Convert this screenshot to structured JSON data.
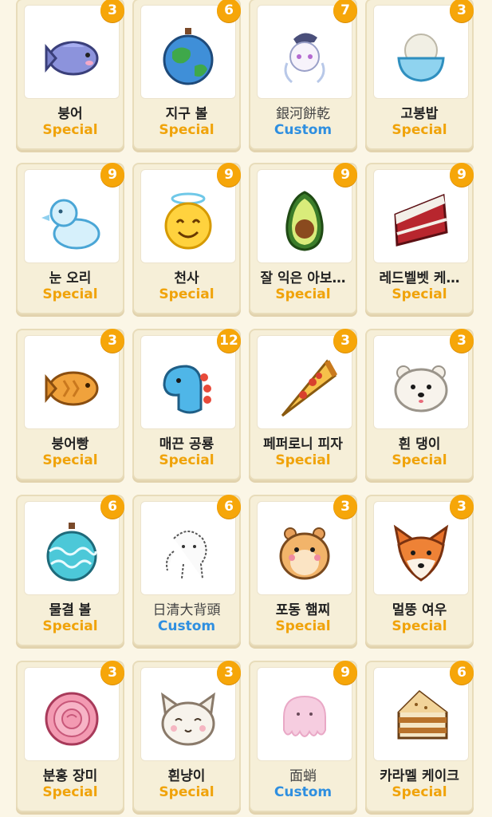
{
  "colors": {
    "special": "#f0a30a",
    "custom": "#2f8fe0",
    "badge": "#f6a609",
    "card_bg": "#f6efd8",
    "page_bg": "#fbf6e6"
  },
  "items": [
    {
      "badge": "3",
      "name": "붕어",
      "type": "Special",
      "icon": "blue-fish-icon"
    },
    {
      "badge": "6",
      "name": "지구 볼",
      "type": "Special",
      "icon": "earth-ornament-icon"
    },
    {
      "badge": "7",
      "name": "銀河餅乾",
      "type": "Custom",
      "icon": "custom-sketch-girl-icon"
    },
    {
      "badge": "3",
      "name": "고봉밥",
      "type": "Special",
      "icon": "rice-bowl-icon"
    },
    {
      "badge": "9",
      "name": "눈 오리",
      "type": "Special",
      "icon": "snow-duck-icon"
    },
    {
      "badge": "9",
      "name": "천사",
      "type": "Special",
      "icon": "angel-face-icon"
    },
    {
      "badge": "9",
      "name": "잘 익은 아보…",
      "type": "Special",
      "icon": "avocado-icon"
    },
    {
      "badge": "9",
      "name": "레드벨벳 케…",
      "type": "Special",
      "icon": "red-velvet-cake-icon"
    },
    {
      "badge": "3",
      "name": "붕어빵",
      "type": "Special",
      "icon": "fish-bread-icon"
    },
    {
      "badge": "12",
      "name": "매끈 공룡",
      "type": "Special",
      "icon": "dinosaur-icon"
    },
    {
      "badge": "3",
      "name": "페퍼로니 피자",
      "type": "Special",
      "icon": "pizza-slice-icon"
    },
    {
      "badge": "3",
      "name": "흰 댕이",
      "type": "Special",
      "icon": "white-dog-icon"
    },
    {
      "badge": "6",
      "name": "물결 볼",
      "type": "Special",
      "icon": "wave-ornament-icon"
    },
    {
      "badge": "6",
      "name": "日清大背頭",
      "type": "Custom",
      "icon": "custom-sketch-outline-icon"
    },
    {
      "badge": "3",
      "name": "포동 햄찌",
      "type": "Special",
      "icon": "hamster-icon"
    },
    {
      "badge": "3",
      "name": "멀뚱 여우",
      "type": "Special",
      "icon": "fox-icon"
    },
    {
      "badge": "3",
      "name": "분홍 장미",
      "type": "Special",
      "icon": "pink-rose-icon"
    },
    {
      "badge": "3",
      "name": "흰냥이",
      "type": "Special",
      "icon": "white-cat-icon"
    },
    {
      "badge": "9",
      "name": "面蛸",
      "type": "Custom",
      "icon": "custom-pink-octopus-icon"
    },
    {
      "badge": "6",
      "name": "카라멜 케이크",
      "type": "Special",
      "icon": "caramel-cake-icon"
    }
  ]
}
